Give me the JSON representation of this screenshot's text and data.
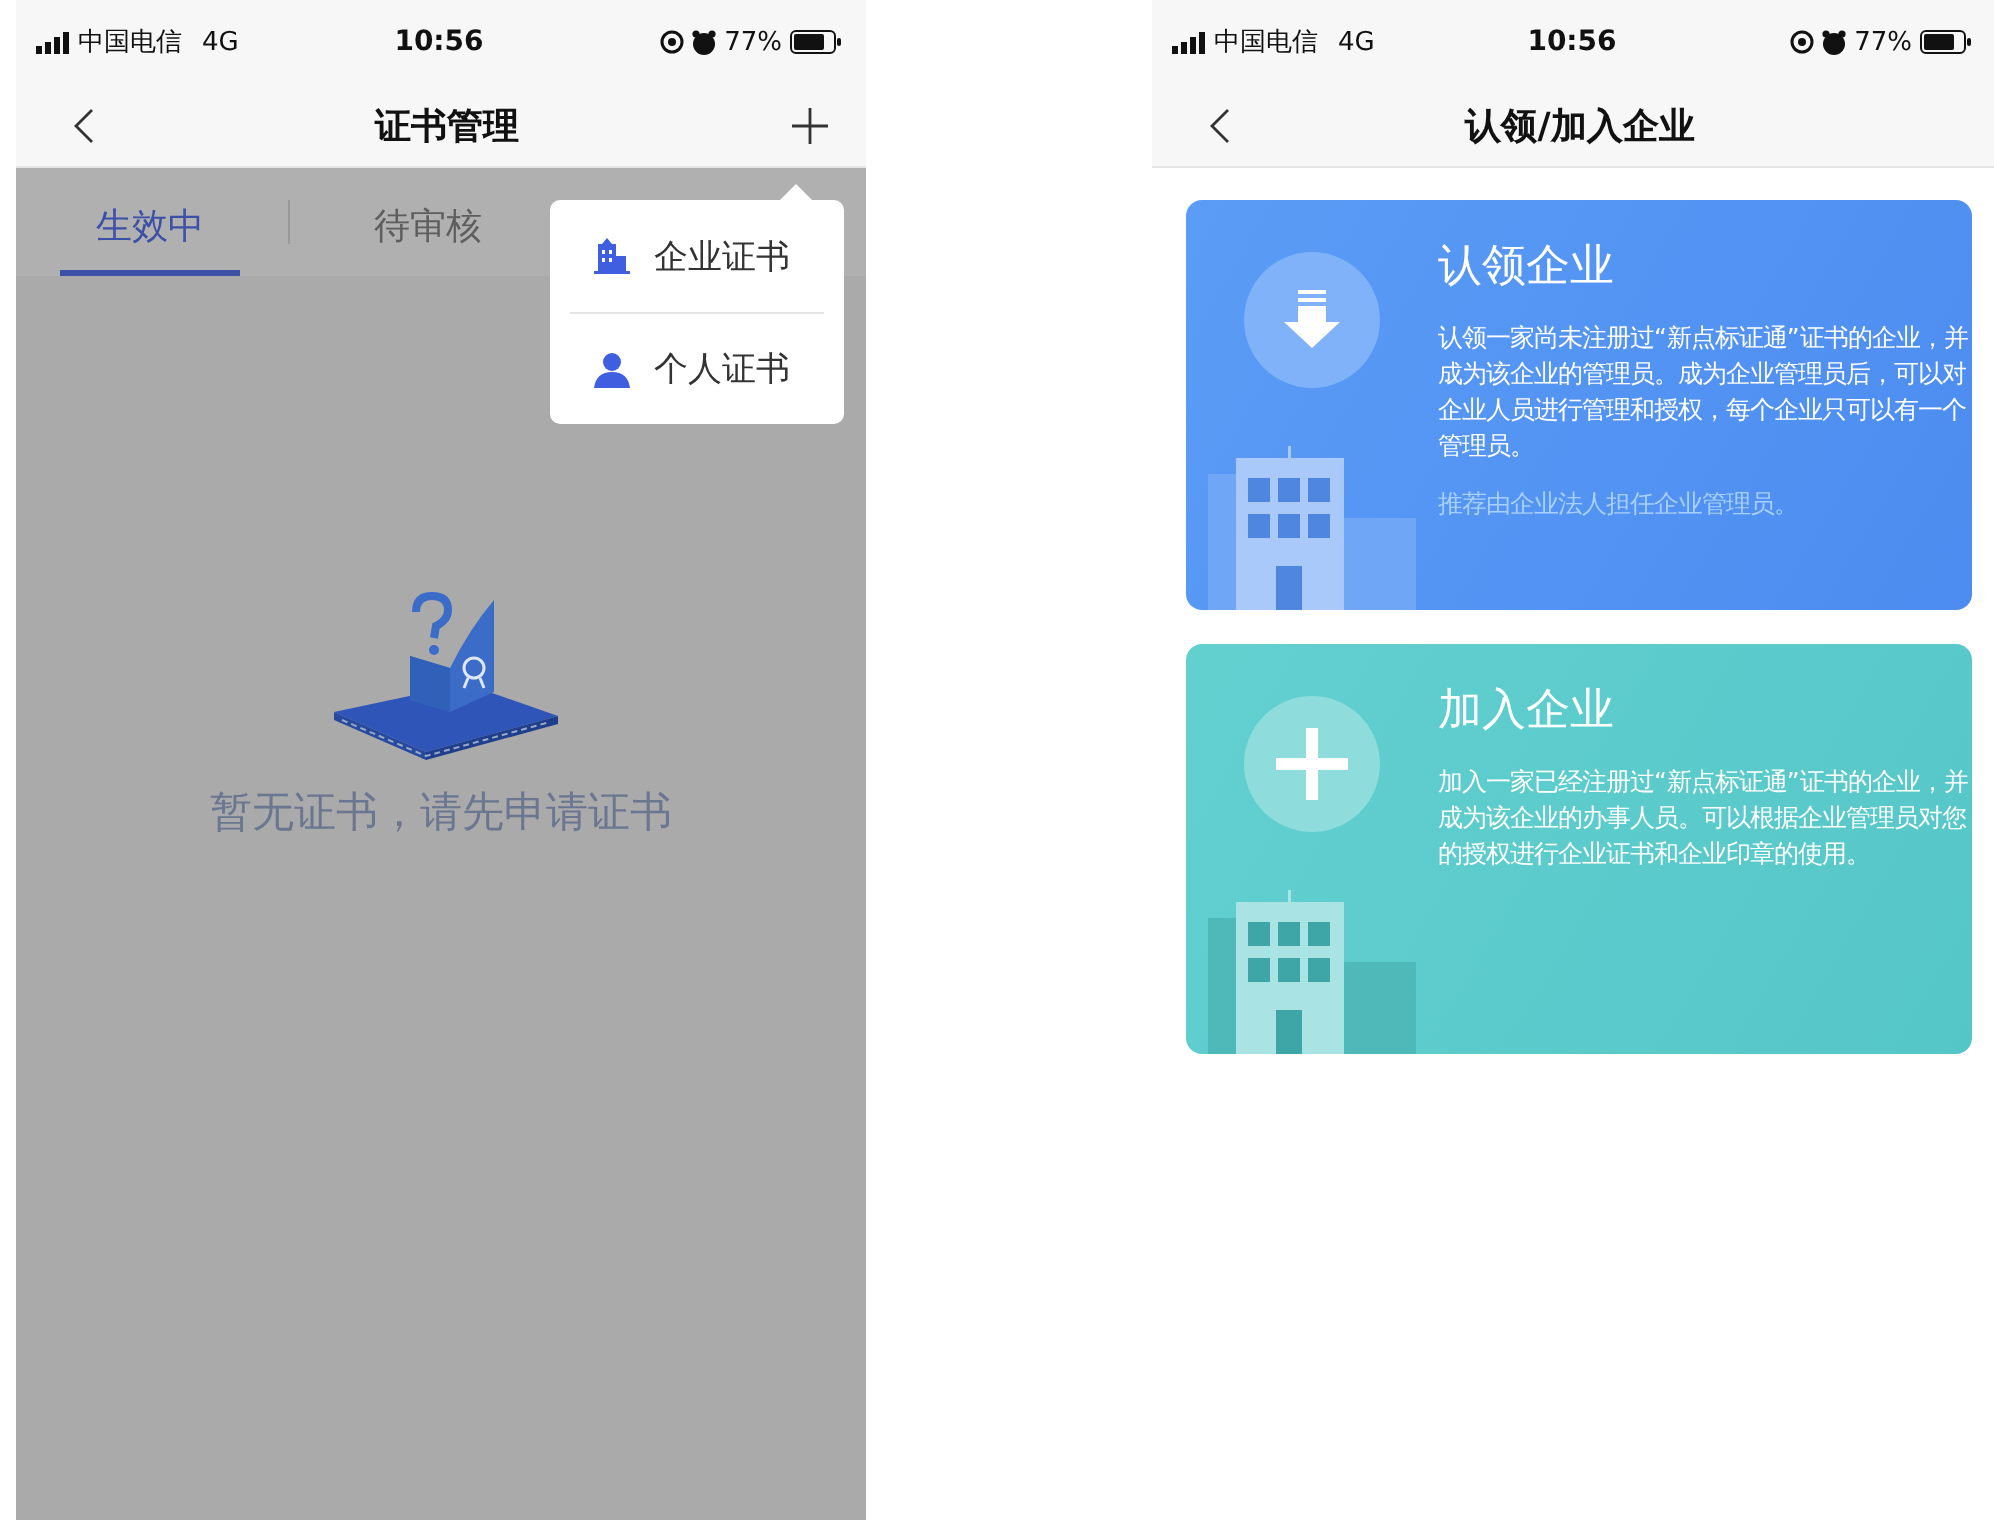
{
  "left_screen": {
    "status_bar": {
      "carrier": "中国电信",
      "network": "4G",
      "time": "10:56",
      "battery": "77%"
    },
    "nav": {
      "title": "证书管理"
    },
    "tabs": [
      {
        "label": "生效中",
        "selected": true
      },
      {
        "label": "待审核",
        "selected": false
      }
    ],
    "menu": [
      {
        "kind": "enterprise",
        "label": "企业证书"
      },
      {
        "kind": "person",
        "label": "个人证书"
      }
    ],
    "empty_message": "暂无证书，请先申请证书"
  },
  "right_screen": {
    "status_bar": {
      "carrier": "中国电信",
      "network": "4G",
      "time": "10:56",
      "battery": "77%"
    },
    "nav": {
      "title": "认领/加入企业"
    },
    "cards": [
      {
        "kind": "claim",
        "title": "认领企业",
        "description": "认领一家尚未注册过“新点标证通”证书的企业，并成为该企业的管理员。成为企业管理员后，可以对企业人员进行管理和授权，每个企业只可以有一个管理员。",
        "note": "推荐由企业法人担任企业管理员。"
      },
      {
        "kind": "join",
        "title": "加入企业",
        "description": "加入一家已经注册过“新点标证通”证书的企业，并成为该企业的办事人员。可以根据企业管理员对您的授权进行企业证书和企业印章的使用。"
      }
    ]
  }
}
